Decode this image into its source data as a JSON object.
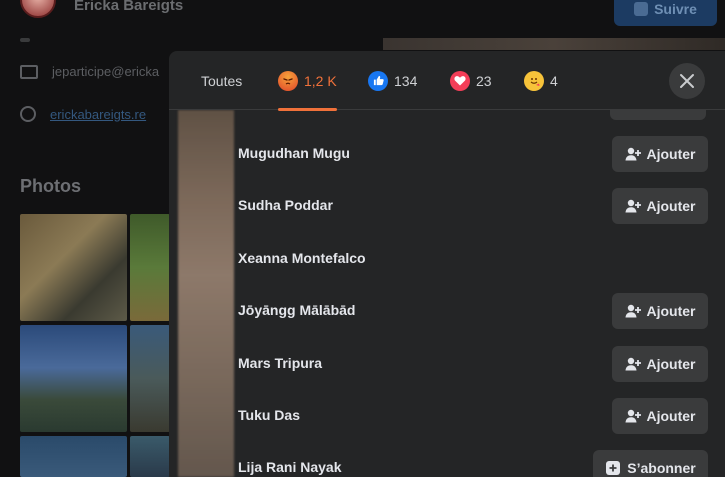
{
  "background": {
    "profile_name": "Ericka Bareigts",
    "follow_label": "Suivre",
    "email": "jeparticipe@ericka",
    "website": "erickabareigts.re",
    "photos_title": "Photos"
  },
  "dialog": {
    "tabs": [
      {
        "label": "Toutes",
        "icon": null
      },
      {
        "label": "1,2 K",
        "icon": "angry-reaction-icon"
      },
      {
        "label": "134",
        "icon": "like-reaction-icon"
      },
      {
        "label": "23",
        "icon": "love-reaction-icon"
      },
      {
        "label": "4",
        "icon": "care-reaction-icon"
      }
    ],
    "active_tab_index": 1,
    "accent_color": "#f0713a",
    "people": [
      {
        "name": "Mugudhan Mugu",
        "action": "Ajouter"
      },
      {
        "name": "Sudha Poddar",
        "action": "Ajouter"
      },
      {
        "name": "Xeanna Montefalco",
        "action": ""
      },
      {
        "name": "Jōyāngg Mālābād",
        "action": "Ajouter"
      },
      {
        "name": "Mars Tripura",
        "action": "Ajouter"
      },
      {
        "name": "Tuku Das",
        "action": "Ajouter"
      },
      {
        "name": "Lija Rani Nayak",
        "action": "S’abonner"
      }
    ]
  }
}
